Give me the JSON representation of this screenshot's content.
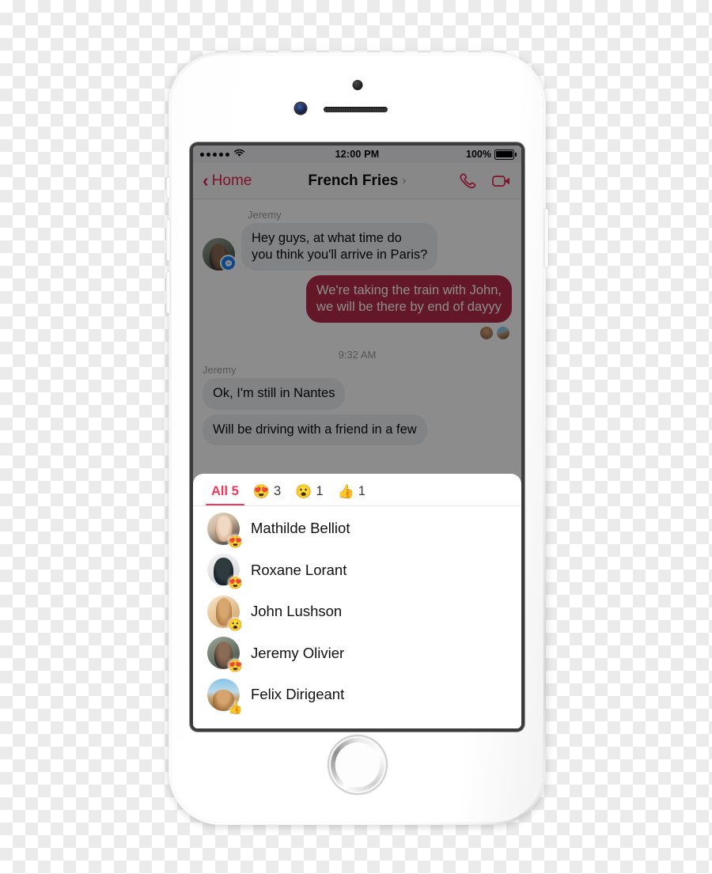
{
  "status_bar": {
    "signal_dots": 5,
    "wifi_icon": "wifi-icon",
    "time": "12:00 PM",
    "battery_percent": "100%"
  },
  "nav_bar": {
    "back_label": "Home",
    "back_chevron": "‹",
    "title": "French Fries",
    "title_caret": "›",
    "call_icon": "phone-icon",
    "video_icon": "video-camera-icon"
  },
  "thread": {
    "messages": [
      {
        "sender": "Jeremy",
        "direction": "incoming",
        "text": "Hey guys, at what time do\nyou think you'll arrive in Paris?",
        "avatar": "jeremy-avatar",
        "badge": "messenger-badge"
      },
      {
        "direction": "outgoing",
        "text": "We're taking the train with John,\nwe will be there by end of dayyy"
      }
    ],
    "read_receipts": [
      "john-avatar",
      "felix-avatar"
    ],
    "timestamp": "9:32 AM",
    "second_group": {
      "sender": "Jeremy",
      "messages": [
        "Ok, I'm still in Nantes",
        "Will be driving with a friend in a few"
      ]
    }
  },
  "reactions_sheet": {
    "tabs": [
      {
        "label": "All 5",
        "emoji": "",
        "count": "",
        "active": true
      },
      {
        "label": "",
        "emoji": "😍",
        "count": "3",
        "active": false
      },
      {
        "label": "",
        "emoji": "😮",
        "count": "1",
        "active": false
      },
      {
        "label": "",
        "emoji": "👍",
        "count": "1",
        "active": false
      }
    ],
    "people": [
      {
        "name": "Mathilde Belliot",
        "reaction": "😍",
        "avatar": "a-mathilde"
      },
      {
        "name": "Roxane Lorant",
        "reaction": "😍",
        "avatar": "a-roxane"
      },
      {
        "name": "John Lushson",
        "reaction": "😮",
        "avatar": "a-john"
      },
      {
        "name": "Jeremy Olivier",
        "reaction": "😍",
        "avatar": "a-jeremy"
      },
      {
        "name": "Felix Dirigeant",
        "reaction": "👍",
        "avatar": "a-felix"
      }
    ]
  },
  "colors": {
    "accent_red": "#e6264f",
    "tab_active": "#f2385a",
    "sent_bubble": "#b72d47",
    "received_bubble": "#eceef1",
    "messenger_blue": "#1a84ff"
  }
}
